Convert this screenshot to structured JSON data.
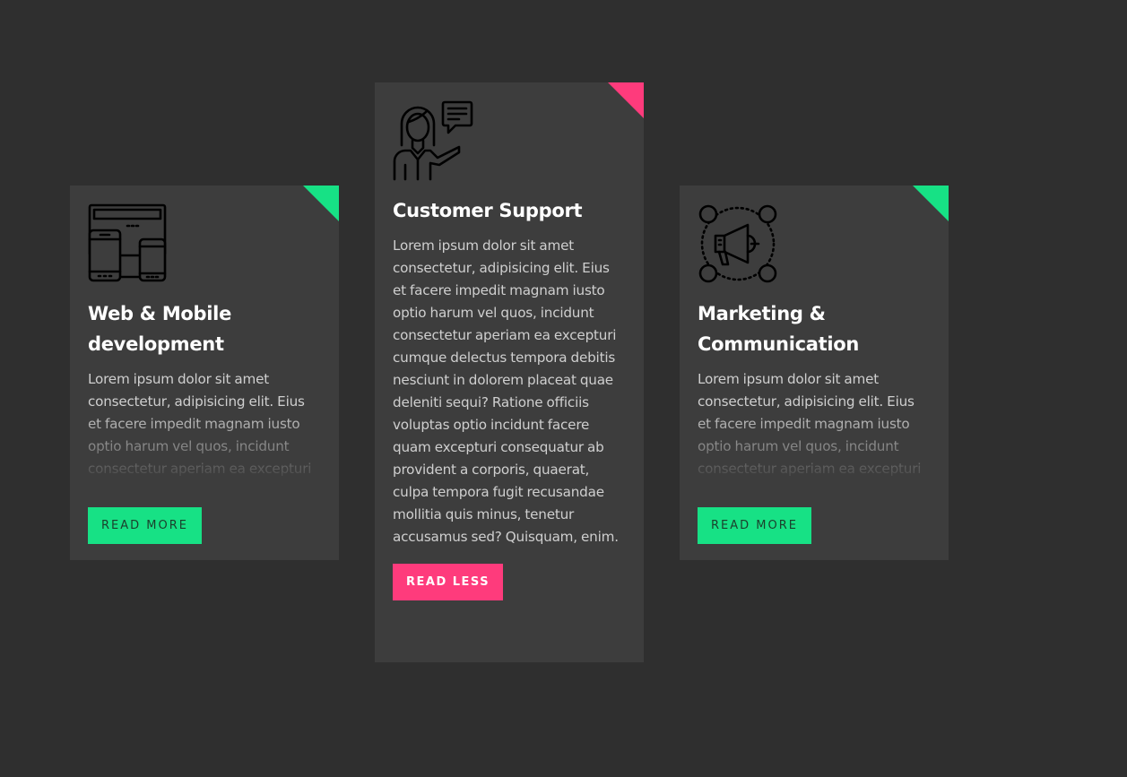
{
  "colors": {
    "background": "#2f2f2f",
    "card": "#3d3d3d",
    "accent_green": "#17e185",
    "accent_pink": "#fe3b7c"
  },
  "cards": [
    {
      "icon": "devices-icon",
      "title": "Web & Mobile development",
      "description": "Lorem ipsum dolor sit amet consectetur, adipisicing elit. Eius et facere impedit magnam iusto optio harum vel quos, incidunt consectetur aperiam ea excepturi cumque delectus",
      "button_label": "READ MORE",
      "expanded": false
    },
    {
      "icon": "customer-support-icon",
      "title": "Customer Support",
      "description": "Lorem ipsum dolor sit amet consectetur, adipisicing elit. Eius et facere impedit magnam iusto optio harum vel quos, incidunt consectetur aperiam ea excepturi cumque delectus tempora debitis nesciunt in dolorem placeat quae deleniti sequi? Ratione officiis voluptas optio incidunt facere quam excepturi consequatur ab provident a corporis, quaerat, culpa tempora fugit recusandae mollitia quis minus, tenetur accusamus sed? Quisquam, enim.",
      "button_label": "READ LESS",
      "expanded": true
    },
    {
      "icon": "megaphone-network-icon",
      "title": "Marketing & Communication",
      "description": "Lorem ipsum dolor sit amet consectetur, adipisicing elit. Eius et facere impedit magnam iusto optio harum vel quos, incidunt consectetur aperiam ea excepturi cumque delectus",
      "button_label": "READ MORE",
      "expanded": false
    }
  ]
}
